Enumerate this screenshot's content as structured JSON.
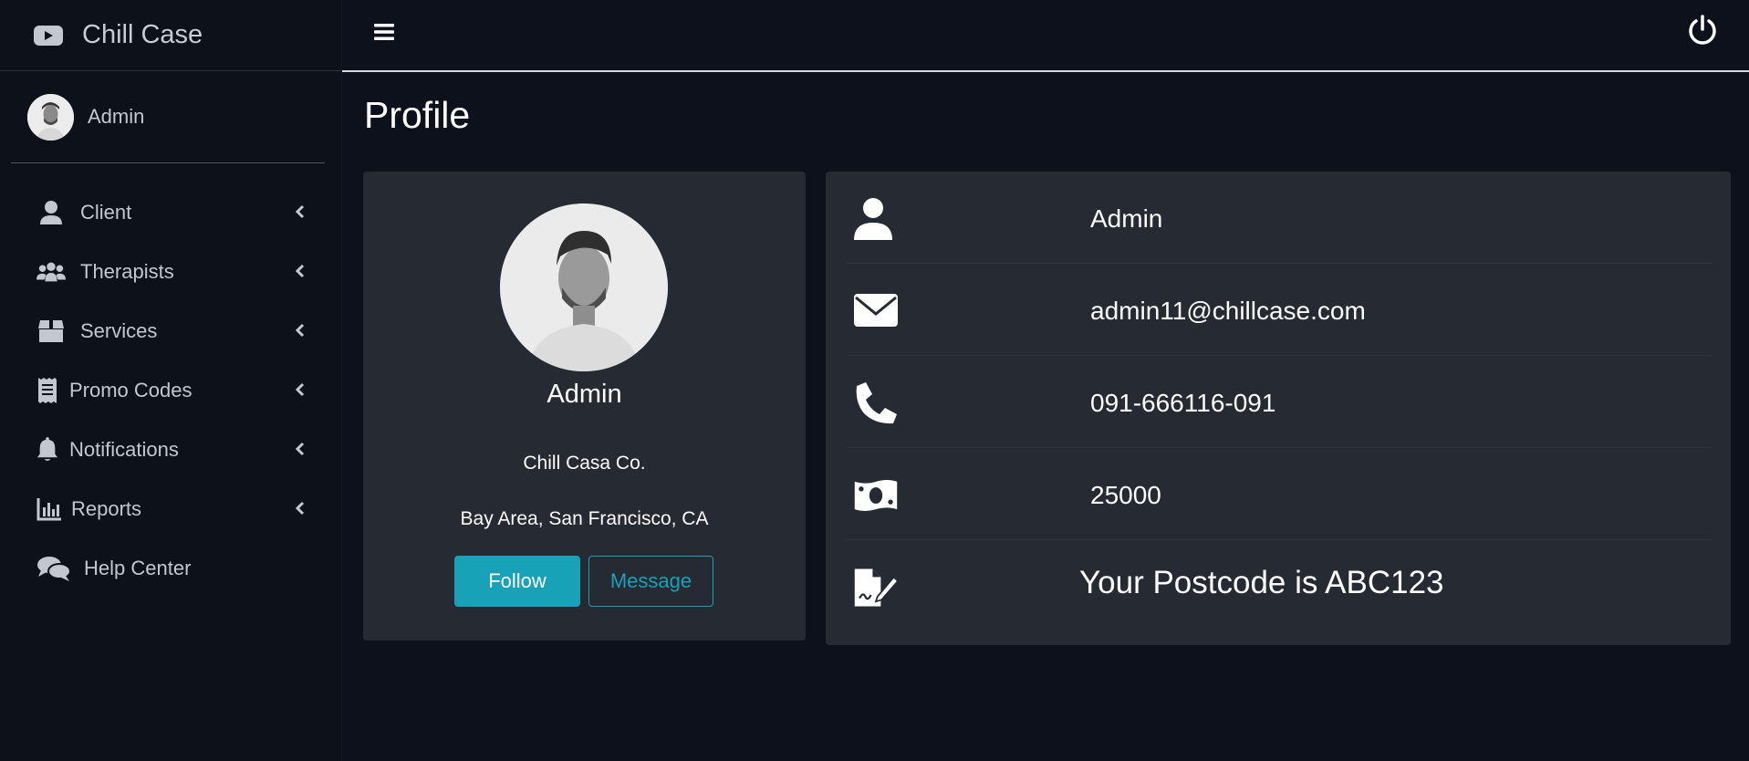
{
  "app": {
    "name": "Chill Case"
  },
  "sidebar": {
    "user": {
      "name": "Admin"
    },
    "items": [
      {
        "label": "Client",
        "icon": "user-icon",
        "has_submenu": true
      },
      {
        "label": "Therapists",
        "icon": "users-icon",
        "has_submenu": true
      },
      {
        "label": "Services",
        "icon": "box-icon",
        "has_submenu": true
      },
      {
        "label": "Promo Codes",
        "icon": "receipt-icon",
        "has_submenu": true
      },
      {
        "label": "Notifications",
        "icon": "bell-icon",
        "has_submenu": true
      },
      {
        "label": "Reports",
        "icon": "chart-icon",
        "has_submenu": true
      },
      {
        "label": "Help Center",
        "icon": "comments-icon",
        "has_submenu": false
      }
    ]
  },
  "page": {
    "title": "Profile"
  },
  "profile_card": {
    "name": "Admin",
    "company": "Chill Casa Co.",
    "address": "Bay Area, San Francisco, CA",
    "follow_label": "Follow",
    "message_label": "Message"
  },
  "details": {
    "name": "Admin",
    "email": "admin11@chillcase.com",
    "phone": "091-666116-091",
    "amount": "25000",
    "postcode": "Your Postcode is ABC123"
  },
  "colors": {
    "background": "#0d111b",
    "card": "#262a33",
    "accent": "#17a2b8"
  }
}
